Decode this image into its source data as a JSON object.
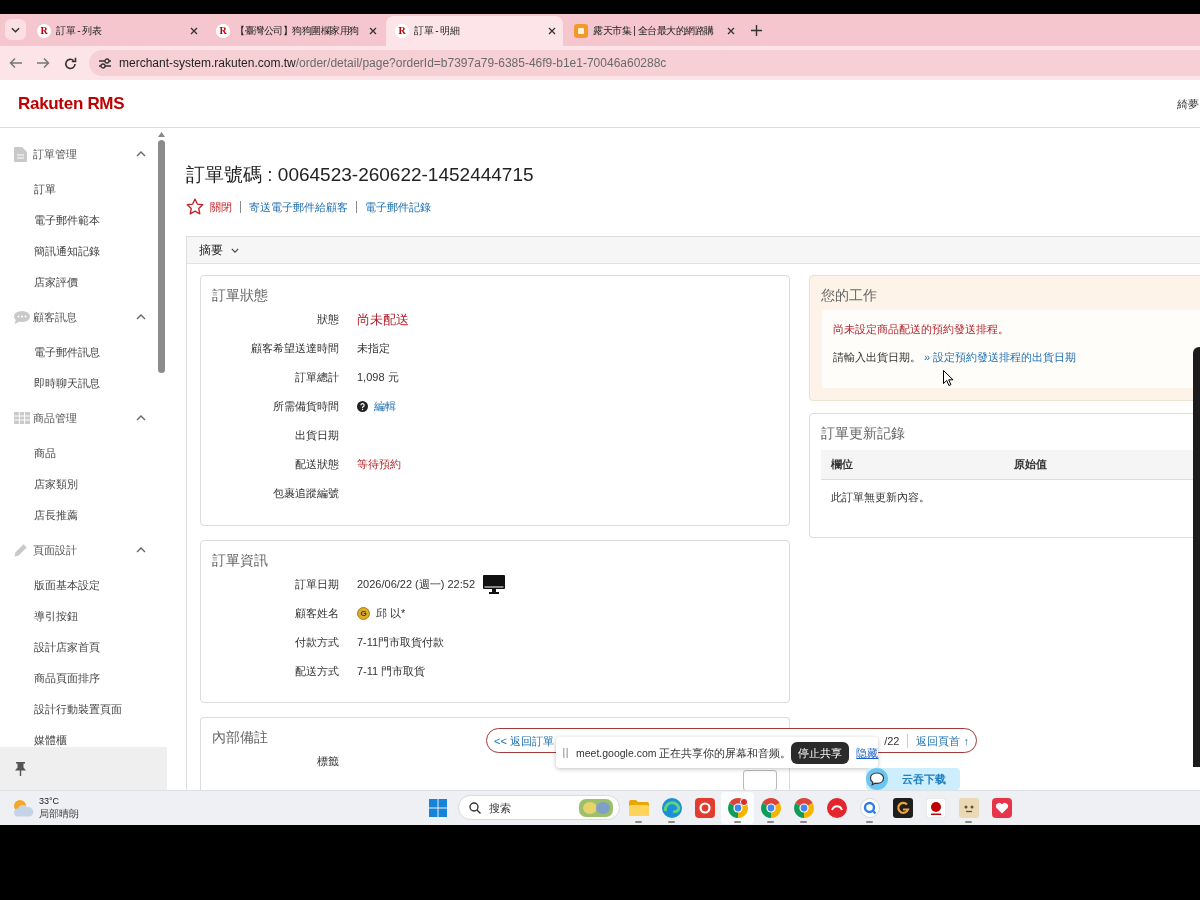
{
  "browser": {
    "tabs": [
      {
        "favicon": {
          "kind": "letter",
          "text": "R"
        },
        "title": "訂單 - 列表",
        "selected": false
      },
      {
        "favicon": {
          "kind": "letter",
          "text": "R"
        },
        "title": "【臺灣公司】狗狗圍欄家用狗",
        "selected": false
      },
      {
        "favicon": {
          "kind": "letter",
          "text": "R"
        },
        "title": "訂單 - 明細",
        "selected": true
      },
      {
        "favicon": {
          "kind": "tile"
        },
        "title": "露天市集 | 全台最大的網路購",
        "selected": false
      }
    ],
    "address": {
      "host": "merchant-system.rakuten.com.tw",
      "path": "/order/detail/page?orderId=b7397a79-6385-46f9-b1e1-70046a60288c"
    }
  },
  "header": {
    "logo": "Rakuten RMS",
    "user": "綺夢"
  },
  "sidebar": {
    "groups": [
      {
        "label": "訂單管理",
        "expanded": true,
        "children": [
          {
            "label": "訂單"
          },
          {
            "label": "電子郵件範本"
          },
          {
            "label": "簡訊通知記錄"
          },
          {
            "label": "店家評價"
          }
        ]
      },
      {
        "label": "顧客訊息",
        "expanded": true,
        "children": [
          {
            "label": "電子郵件訊息"
          },
          {
            "label": "即時聊天訊息"
          }
        ]
      },
      {
        "label": "商品管理",
        "expanded": true,
        "children": [
          {
            "label": "商品"
          },
          {
            "label": "店家類別"
          },
          {
            "label": "店長推薦"
          }
        ]
      },
      {
        "label": "頁面設計",
        "expanded": true,
        "children": [
          {
            "label": "版面基本設定"
          },
          {
            "label": "導引按鈕"
          },
          {
            "label": "設計店家首頁"
          },
          {
            "label": "商品頁面排序"
          },
          {
            "label": "設計行動裝置頁面"
          },
          {
            "label": "媒體櫃"
          }
        ]
      }
    ]
  },
  "order": {
    "title": "訂單號碼 : 0064523-260622-1452444715",
    "starred": false,
    "actions": [
      {
        "kind": "danger",
        "label": "關閉"
      },
      {
        "kind": "link",
        "label": "寄送電子郵件給顧客"
      },
      {
        "kind": "link",
        "label": "電子郵件記錄"
      }
    ]
  },
  "summary": {
    "title": "摘要",
    "order_status": {
      "title": "訂單狀態",
      "fields": [
        {
          "label": "狀態",
          "kind": "status",
          "value": "尚未配送"
        },
        {
          "label": "顧客希望送達時間",
          "kind": "text",
          "value": "未指定"
        },
        {
          "label": "訂單總計",
          "kind": "text",
          "value": "1,098 元"
        },
        {
          "label": "所需備貨時間",
          "kind": "help_link",
          "value": "編輯"
        },
        {
          "label": "出貨日期",
          "kind": "text"
        },
        {
          "label": "配送狀態",
          "kind": "warning",
          "value": "等待預約"
        },
        {
          "label": "包裹追蹤編號",
          "kind": "text"
        }
      ]
    },
    "order_info": {
      "title": "訂單資訊",
      "fields": [
        {
          "label": "訂單日期",
          "kind": "device",
          "value": "2026/06/22 (週一) 22:52"
        },
        {
          "label": "顧客姓名",
          "kind": "member",
          "badge": "G",
          "value": "邱 以*"
        },
        {
          "label": "付款方式",
          "kind": "text",
          "value": "7-11門市取貨付款"
        },
        {
          "label": "配送方式",
          "kind": "text",
          "value": "7-11 門市取貨"
        }
      ]
    },
    "internal_notes": {
      "title": "內部備註",
      "fields": [
        {
          "label": "標籤",
          "kind": "button"
        }
      ]
    },
    "your_tasks": {
      "title": "您的工作",
      "alert": "尚未設定商品配送的預約發送排程。",
      "instruction": "請輸入出貨日期。",
      "link": "» 設定預約發送排程的出貨日期"
    },
    "update_history": {
      "title": "訂單更新記錄",
      "columns": [
        "欄位",
        "原始值"
      ],
      "empty_message": "此訂單無更新內容。"
    }
  },
  "floating_nav": {
    "back": "<< 返回訂單",
    "fragment": "/22",
    "top": "返回頁首 ↑"
  },
  "screen_share_bar": {
    "message": "meet.google.com 正在共享你的屏幕和音频。",
    "stop": "停止共享",
    "hide": "隐藏"
  },
  "download_button": {
    "label": "云吞下载"
  },
  "taskbar": {
    "weather": {
      "temperature": "33°C",
      "condition": "局部晴朗"
    },
    "search": {
      "placeholder": "搜索"
    },
    "apps": [
      {
        "running": true,
        "selected": false
      },
      {
        "running": true,
        "selected": false
      },
      {
        "running": false,
        "selected": false
      },
      {
        "running": true,
        "selected": true
      },
      {
        "running": true,
        "selected": false
      },
      {
        "running": true,
        "selected": false
      },
      {
        "running": false,
        "selected": false
      },
      {
        "running": true,
        "selected": false
      },
      {
        "running": false,
        "selected": false
      },
      {
        "running": false,
        "selected": false
      },
      {
        "running": true,
        "selected": false
      },
      {
        "running": false,
        "selected": false
      }
    ]
  }
}
